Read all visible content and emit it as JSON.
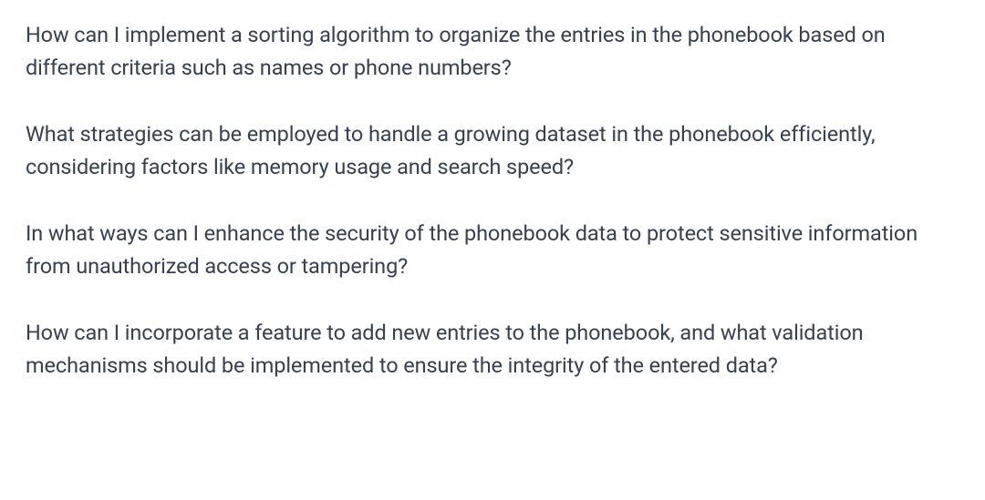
{
  "paragraphs": [
    "How can I implement a sorting algorithm to organize the entries in the phonebook based on different criteria such as names or phone numbers?",
    "What strategies can be employed to handle a growing dataset in the phonebook efficiently, considering factors like memory usage and search speed?",
    "In what ways can I enhance the security of the phonebook data to protect sensitive information from unauthorized access or tampering?",
    "How can I incorporate a feature to add new entries to the phonebook, and what validation mechanisms should be implemented to ensure the integrity of the entered data?"
  ]
}
